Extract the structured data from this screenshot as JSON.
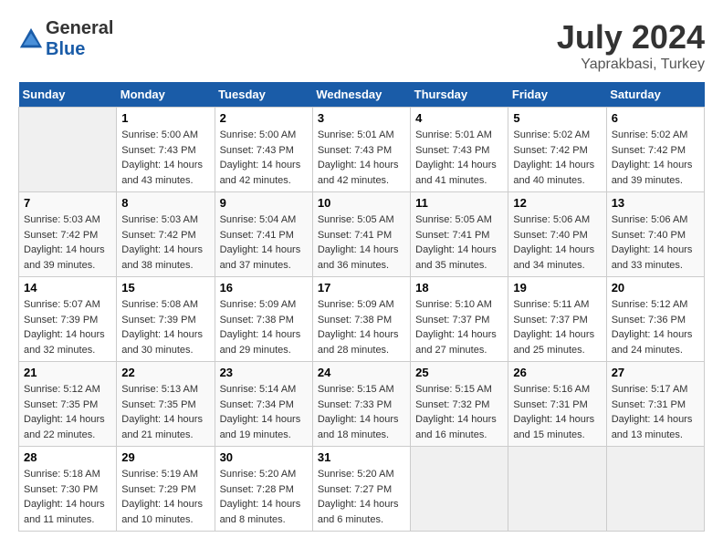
{
  "header": {
    "logo_general": "General",
    "logo_blue": "Blue",
    "title": "July 2024",
    "subtitle": "Yaprakbasi, Turkey"
  },
  "calendar": {
    "days_of_week": [
      "Sunday",
      "Monday",
      "Tuesday",
      "Wednesday",
      "Thursday",
      "Friday",
      "Saturday"
    ],
    "weeks": [
      [
        {
          "day": "",
          "info": ""
        },
        {
          "day": "1",
          "info": "Sunrise: 5:00 AM\nSunset: 7:43 PM\nDaylight: 14 hours\nand 43 minutes."
        },
        {
          "day": "2",
          "info": "Sunrise: 5:00 AM\nSunset: 7:43 PM\nDaylight: 14 hours\nand 42 minutes."
        },
        {
          "day": "3",
          "info": "Sunrise: 5:01 AM\nSunset: 7:43 PM\nDaylight: 14 hours\nand 42 minutes."
        },
        {
          "day": "4",
          "info": "Sunrise: 5:01 AM\nSunset: 7:43 PM\nDaylight: 14 hours\nand 41 minutes."
        },
        {
          "day": "5",
          "info": "Sunrise: 5:02 AM\nSunset: 7:42 PM\nDaylight: 14 hours\nand 40 minutes."
        },
        {
          "day": "6",
          "info": "Sunrise: 5:02 AM\nSunset: 7:42 PM\nDaylight: 14 hours\nand 39 minutes."
        }
      ],
      [
        {
          "day": "7",
          "info": "Sunrise: 5:03 AM\nSunset: 7:42 PM\nDaylight: 14 hours\nand 39 minutes."
        },
        {
          "day": "8",
          "info": "Sunrise: 5:03 AM\nSunset: 7:42 PM\nDaylight: 14 hours\nand 38 minutes."
        },
        {
          "day": "9",
          "info": "Sunrise: 5:04 AM\nSunset: 7:41 PM\nDaylight: 14 hours\nand 37 minutes."
        },
        {
          "day": "10",
          "info": "Sunrise: 5:05 AM\nSunset: 7:41 PM\nDaylight: 14 hours\nand 36 minutes."
        },
        {
          "day": "11",
          "info": "Sunrise: 5:05 AM\nSunset: 7:41 PM\nDaylight: 14 hours\nand 35 minutes."
        },
        {
          "day": "12",
          "info": "Sunrise: 5:06 AM\nSunset: 7:40 PM\nDaylight: 14 hours\nand 34 minutes."
        },
        {
          "day": "13",
          "info": "Sunrise: 5:06 AM\nSunset: 7:40 PM\nDaylight: 14 hours\nand 33 minutes."
        }
      ],
      [
        {
          "day": "14",
          "info": "Sunrise: 5:07 AM\nSunset: 7:39 PM\nDaylight: 14 hours\nand 32 minutes."
        },
        {
          "day": "15",
          "info": "Sunrise: 5:08 AM\nSunset: 7:39 PM\nDaylight: 14 hours\nand 30 minutes."
        },
        {
          "day": "16",
          "info": "Sunrise: 5:09 AM\nSunset: 7:38 PM\nDaylight: 14 hours\nand 29 minutes."
        },
        {
          "day": "17",
          "info": "Sunrise: 5:09 AM\nSunset: 7:38 PM\nDaylight: 14 hours\nand 28 minutes."
        },
        {
          "day": "18",
          "info": "Sunrise: 5:10 AM\nSunset: 7:37 PM\nDaylight: 14 hours\nand 27 minutes."
        },
        {
          "day": "19",
          "info": "Sunrise: 5:11 AM\nSunset: 7:37 PM\nDaylight: 14 hours\nand 25 minutes."
        },
        {
          "day": "20",
          "info": "Sunrise: 5:12 AM\nSunset: 7:36 PM\nDaylight: 14 hours\nand 24 minutes."
        }
      ],
      [
        {
          "day": "21",
          "info": "Sunrise: 5:12 AM\nSunset: 7:35 PM\nDaylight: 14 hours\nand 22 minutes."
        },
        {
          "day": "22",
          "info": "Sunrise: 5:13 AM\nSunset: 7:35 PM\nDaylight: 14 hours\nand 21 minutes."
        },
        {
          "day": "23",
          "info": "Sunrise: 5:14 AM\nSunset: 7:34 PM\nDaylight: 14 hours\nand 19 minutes."
        },
        {
          "day": "24",
          "info": "Sunrise: 5:15 AM\nSunset: 7:33 PM\nDaylight: 14 hours\nand 18 minutes."
        },
        {
          "day": "25",
          "info": "Sunrise: 5:15 AM\nSunset: 7:32 PM\nDaylight: 14 hours\nand 16 minutes."
        },
        {
          "day": "26",
          "info": "Sunrise: 5:16 AM\nSunset: 7:31 PM\nDaylight: 14 hours\nand 15 minutes."
        },
        {
          "day": "27",
          "info": "Sunrise: 5:17 AM\nSunset: 7:31 PM\nDaylight: 14 hours\nand 13 minutes."
        }
      ],
      [
        {
          "day": "28",
          "info": "Sunrise: 5:18 AM\nSunset: 7:30 PM\nDaylight: 14 hours\nand 11 minutes."
        },
        {
          "day": "29",
          "info": "Sunrise: 5:19 AM\nSunset: 7:29 PM\nDaylight: 14 hours\nand 10 minutes."
        },
        {
          "day": "30",
          "info": "Sunrise: 5:20 AM\nSunset: 7:28 PM\nDaylight: 14 hours\nand 8 minutes."
        },
        {
          "day": "31",
          "info": "Sunrise: 5:20 AM\nSunset: 7:27 PM\nDaylight: 14 hours\nand 6 minutes."
        },
        {
          "day": "",
          "info": ""
        },
        {
          "day": "",
          "info": ""
        },
        {
          "day": "",
          "info": ""
        }
      ]
    ]
  }
}
